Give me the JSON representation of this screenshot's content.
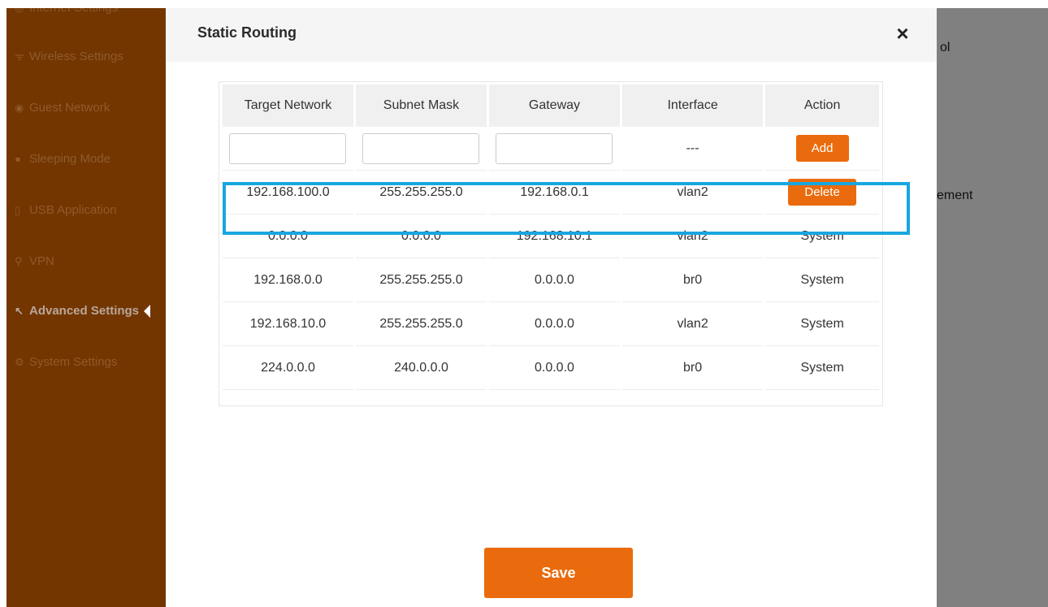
{
  "sidebar": {
    "items": [
      {
        "label": "Internet Settings",
        "icon": "globe-icon"
      },
      {
        "label": "Wireless Settings",
        "icon": "wifi-icon"
      },
      {
        "label": "Guest Network",
        "icon": "guest-icon"
      },
      {
        "label": "Sleeping Mode",
        "icon": "moon-icon"
      },
      {
        "label": "USB Application",
        "icon": "usb-icon"
      },
      {
        "label": "VPN",
        "icon": "vpn-icon"
      },
      {
        "label": "Advanced Settings",
        "icon": "wrench-icon",
        "active": true
      },
      {
        "label": "System Settings",
        "icon": "gear-icon"
      }
    ]
  },
  "background": {
    "right_texts": [
      "ol",
      "ement"
    ]
  },
  "modal": {
    "title": "Static Routing",
    "close_symbol": "×",
    "save_label": "Save",
    "table": {
      "headers": [
        "Target Network",
        "Subnet Mask",
        "Gateway",
        "Interface",
        "Action"
      ],
      "input_row": {
        "interface": "---",
        "action_label": "Add"
      },
      "rows": [
        [
          "192.168.100.0",
          "255.255.255.0",
          "192.168.0.1",
          "vlan2",
          "Delete"
        ],
        [
          "0.0.0.0",
          "0.0.0.0",
          "192.168.10.1",
          "vlan2",
          "System"
        ],
        [
          "192.168.0.0",
          "255.255.255.0",
          "0.0.0.0",
          "br0",
          "System"
        ],
        [
          "192.168.10.0",
          "255.255.255.0",
          "0.0.0.0",
          "vlan2",
          "System"
        ],
        [
          "224.0.0.0",
          "240.0.0.0",
          "0.0.0.0",
          "br0",
          "System"
        ]
      ]
    }
  },
  "colors": {
    "accent": "#ea6b0d",
    "sidebar_bg": "#733601",
    "highlight": "#19a6e0",
    "overlay": "#808080"
  }
}
